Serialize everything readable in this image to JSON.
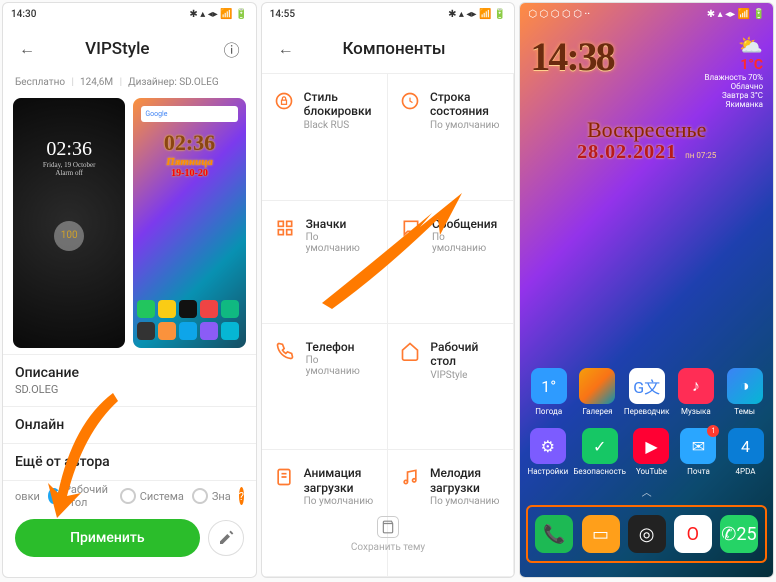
{
  "screen1": {
    "statusbar": {
      "time": "14:30",
      "indicators": "⬡ ⬡ ⬡",
      "right": "✱ ▴ ◂▸ 📶 🔋"
    },
    "header": {
      "title": "VIPStyle",
      "back": "←",
      "info": "ⓘ"
    },
    "meta": {
      "price": "Бесплатно",
      "size": "124,6M",
      "designer": "Дизайнер: SD.OLEG"
    },
    "preview1": {
      "clock": "02:36",
      "date": "Friday, 19 October",
      "alarm": "Alarm off"
    },
    "preview2": {
      "search": "Google",
      "clock": "02:36",
      "day": "Пятница",
      "date": "19-10-20"
    },
    "section_desc_title": "Описание",
    "section_desc_body": "SD.OLEG",
    "section_online_title": "Онлайн",
    "section_more_title": "Ещё от автора",
    "chips": {
      "c0_label": "овки",
      "c1_label": "Рабочий стол",
      "c2_label": "Система",
      "c3_label": "Зна"
    },
    "apply": "Применить"
  },
  "screen2": {
    "statusbar": {
      "time": "14:55",
      "indicators": "⬡ ⬡ ⬡ ⬡ ··",
      "right": "✱ ▴ ◂▸ 📶 🔋"
    },
    "header": {
      "title": "Компоненты",
      "back": "←"
    },
    "cells": [
      {
        "title": "Стиль блокировки",
        "sub": "Black RUS",
        "icon": "lock"
      },
      {
        "title": "Строка состояния",
        "sub": "По умолчанию",
        "icon": "status"
      },
      {
        "title": "Значки",
        "sub": "По умолчанию",
        "icon": "icons"
      },
      {
        "title": "Сообщения",
        "sub": "По умолчанию",
        "icon": "chat"
      },
      {
        "title": "Телефон",
        "sub": "По умолчанию",
        "icon": "phone"
      },
      {
        "title": "Рабочий стол",
        "sub": "VIPStyle",
        "icon": "home"
      },
      {
        "title": "Анимация загрузки",
        "sub": "По умолчанию",
        "icon": "anim"
      },
      {
        "title": "Мелодия загрузки",
        "sub": "По умолчанию",
        "icon": "audio"
      }
    ],
    "save": "Сохранить тему"
  },
  "screen3": {
    "statusbar": {
      "left": "⬡ ⬡ ⬡ ⬡ ⬡ ··",
      "right": "✱ ▴ ◂▸ 📶 🔋"
    },
    "clock": "14:38",
    "weather": {
      "temp": "1°С",
      "hum": "Влажность 70%",
      "cond": "Облачно",
      "tom": "Завтра 3°С",
      "loc": "Якиманка",
      "sun": "пн 07:25"
    },
    "day": "Воскресенье",
    "date": "28.02.2021",
    "row1": [
      {
        "label": "Погода",
        "bg": "#2e9bff",
        "glyph": "1°"
      },
      {
        "label": "Галерея",
        "bg": "linear-gradient(135deg,#f59e0b,#f97316,#0891b2)",
        "glyph": ""
      },
      {
        "label": "Переводчик",
        "bg": "#ffffff",
        "glyph": "G文",
        "fg": "#4285f4"
      },
      {
        "label": "Музыка",
        "bg": "#ff2d55",
        "glyph": "♪"
      },
      {
        "label": "Темы",
        "bg": "linear-gradient(135deg,#3b82f6,#06b6d4)",
        "glyph": "◑"
      }
    ],
    "row2": [
      {
        "label": "Настройки",
        "bg": "#7c5cff",
        "glyph": "⚙"
      },
      {
        "label": "Безопасность",
        "bg": "#16c765",
        "glyph": "✓"
      },
      {
        "label": "YouTube",
        "bg": "#ff0033",
        "glyph": "▶"
      },
      {
        "label": "Почта",
        "bg": "#2aa6ff",
        "glyph": "✉",
        "badge": "1"
      },
      {
        "label": "4PDA",
        "bg": "#0a7dd6",
        "glyph": "4"
      }
    ],
    "dock": [
      {
        "bg": "#1db954",
        "glyph": "📞"
      },
      {
        "bg": "#ff9f1a",
        "glyph": "▭"
      },
      {
        "bg": "#222",
        "glyph": "◎"
      },
      {
        "bg": "#fff",
        "glyph": "O",
        "fg": "#ff1a1a"
      },
      {
        "bg": "#25d366",
        "glyph": "✆",
        "badge": "25"
      }
    ]
  }
}
